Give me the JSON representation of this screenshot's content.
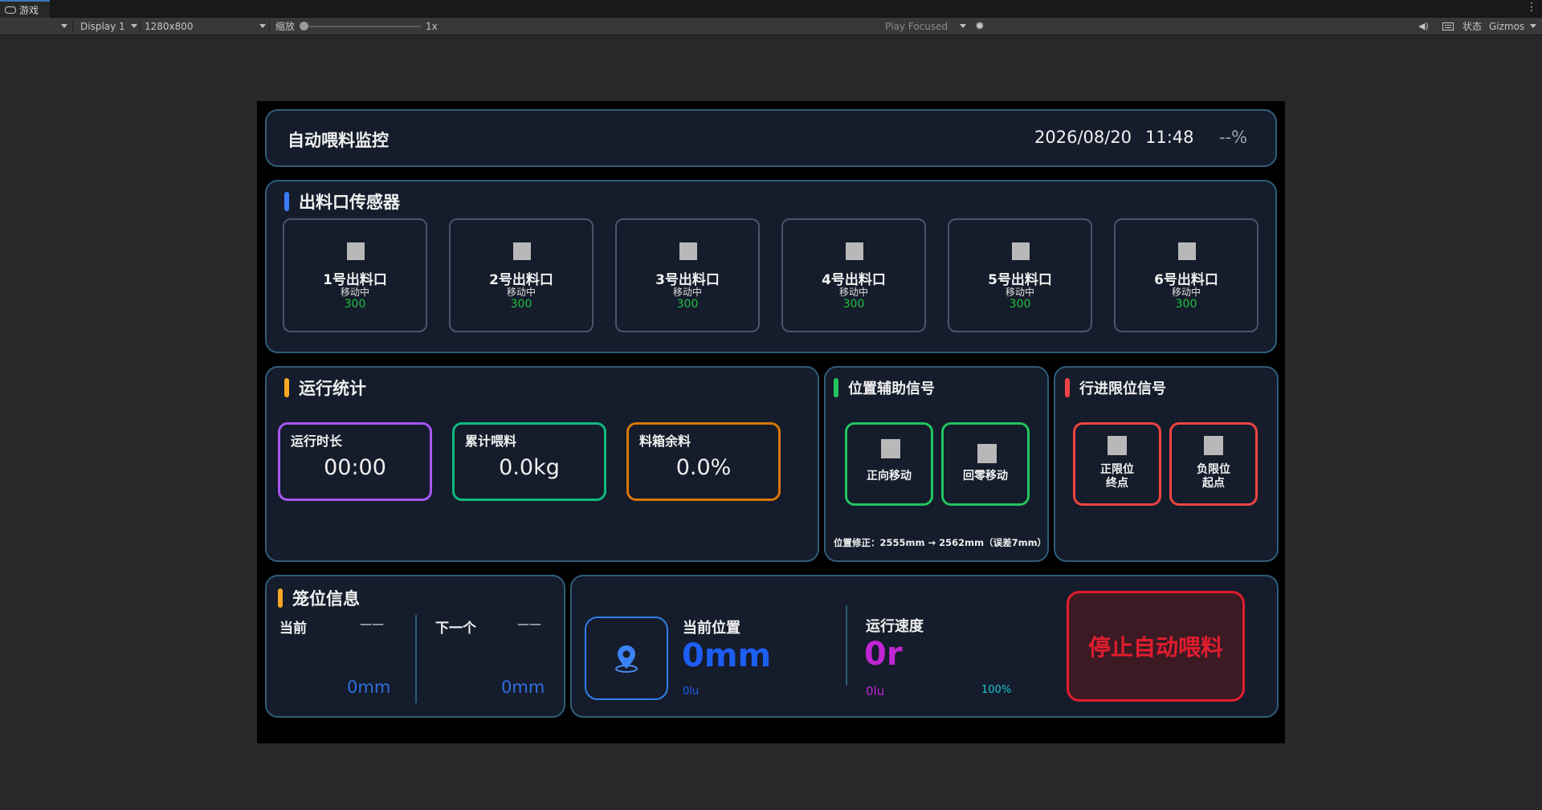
{
  "editor": {
    "tab_label": "游戏",
    "display": "Display 1",
    "resolution": "1280x800",
    "scale_label": "缩放",
    "scale_value": "1x",
    "play_mode": "Play Focused",
    "status_label": "状态",
    "gizmos_label": "Gizmos"
  },
  "header": {
    "title": "自动喂料监控",
    "date": "2026/08/20",
    "time": "11:48",
    "percent": "--%"
  },
  "sensors": {
    "title": "出料口传感器",
    "accent": "#3b7bf5",
    "items": [
      {
        "name": "1号出料口",
        "status": "移动中",
        "value": "300"
      },
      {
        "name": "2号出料口",
        "status": "移动中",
        "value": "300"
      },
      {
        "name": "3号出料口",
        "status": "移动中",
        "value": "300"
      },
      {
        "name": "4号出料口",
        "status": "移动中",
        "value": "300"
      },
      {
        "name": "5号出料口",
        "status": "移动中",
        "value": "300"
      },
      {
        "name": "6号出料口",
        "status": "移动中",
        "value": "300"
      }
    ]
  },
  "stats": {
    "title": "运行统计",
    "accent": "#f5a623",
    "items": [
      {
        "label": "运行时长",
        "value": "00:00",
        "color": "#a855f7"
      },
      {
        "label": "累计喂料",
        "value": "0.0kg",
        "color": "#10b981"
      },
      {
        "label": "料箱余料",
        "value": "0.0%",
        "color": "#d97706"
      }
    ]
  },
  "position_signals": {
    "title": "位置辅助信号",
    "accent": "#22c55e",
    "forward": "正向移动",
    "home": "回零移动",
    "correction": "位置修正：2555mm → 2562mm（误差7mm）"
  },
  "limit_signals": {
    "title": "行进限位信号",
    "accent": "#ef4444",
    "positive_line1": "正限位",
    "positive_line2": "终点",
    "negative_line1": "负限位",
    "negative_line2": "起点"
  },
  "cage": {
    "title": "笼位信息",
    "accent": "#f5a623",
    "current_label": "当前",
    "current_value": "——",
    "current_mm": "0mm",
    "next_label": "下一个",
    "next_value": "——",
    "next_mm": "0mm"
  },
  "motion": {
    "position_label": "当前位置",
    "position_value": "0mm",
    "position_sub": "0lu",
    "speed_label": "运行速度",
    "speed_value": "0r",
    "speed_sub": "0lu",
    "speed_percent": "100%",
    "stop_button": "停止自动喂料",
    "position_color": "#1d5ef5",
    "speed_color": "#c026d3",
    "stop_color": "#e11d2e"
  },
  "icons": [
    "gamepad-icon",
    "kebab-menu-icon",
    "bug-icon",
    "speaker-icon",
    "keyboard-icon",
    "location-pin-icon"
  ]
}
